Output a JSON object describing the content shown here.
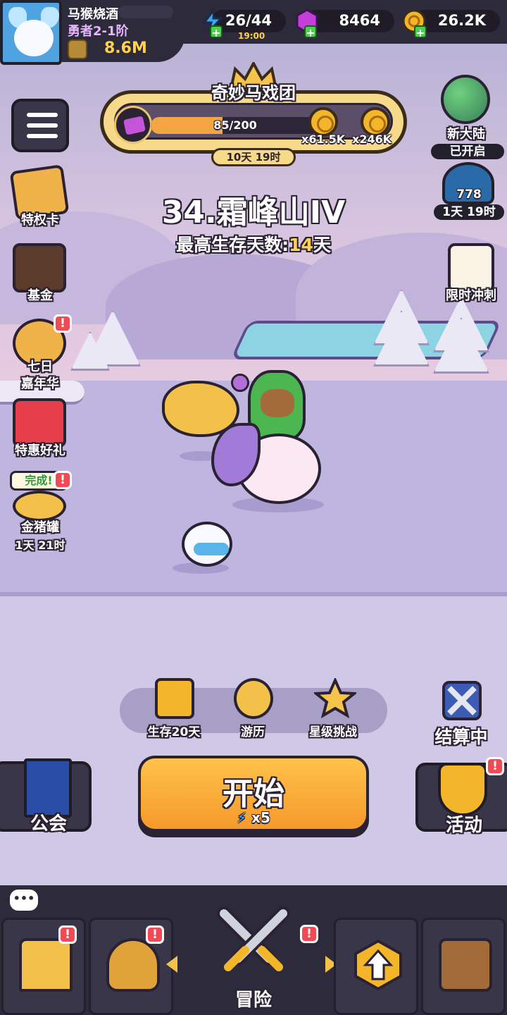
{
  "player": {
    "name": "马猴烧酒",
    "rank": "勇者2-1阶",
    "power": "8.6M"
  },
  "resources": {
    "energy": "26/44",
    "energy_timer": "19:00",
    "gems": "8464",
    "gold": "26.2K"
  },
  "event": {
    "title": "奇妙马戏团",
    "progress_text": "85/200",
    "progress_fraction": 0.425,
    "reward_1": "x61.5K",
    "reward_2": "x246K",
    "timer": "10天 19时"
  },
  "stage": {
    "title": "34.霜峰山IV",
    "best_prefix": "最高生存天数:",
    "best_days": "14",
    "best_suffix": "天"
  },
  "left_menu": {
    "privilege": "特权卡",
    "fund": "基金",
    "seven_day_1": "七日",
    "seven_day_2": "嘉年华",
    "special_gift": "特惠好礼",
    "piggy_done": "完成!",
    "piggy": "金猪罐",
    "piggy_timer": "1天 21时"
  },
  "right_menu": {
    "new_world": "新大陆",
    "new_world_status": "已开启",
    "chapter_number": "778",
    "chapter_timer": "1天 19时",
    "sprint": "限时冲刺"
  },
  "shortcuts": {
    "survive": "生存20天",
    "travel": "游历",
    "star_challenge": "星级挑战",
    "settling": "结算中"
  },
  "start": {
    "label": "开始",
    "cost": "x5"
  },
  "guild": "公会",
  "activity": "活动",
  "badge": "!",
  "nav": {
    "adventure": "冒险"
  },
  "icons": {
    "energy": "lightning-icon",
    "gems": "gem-icon",
    "gold": "coin-icon"
  }
}
